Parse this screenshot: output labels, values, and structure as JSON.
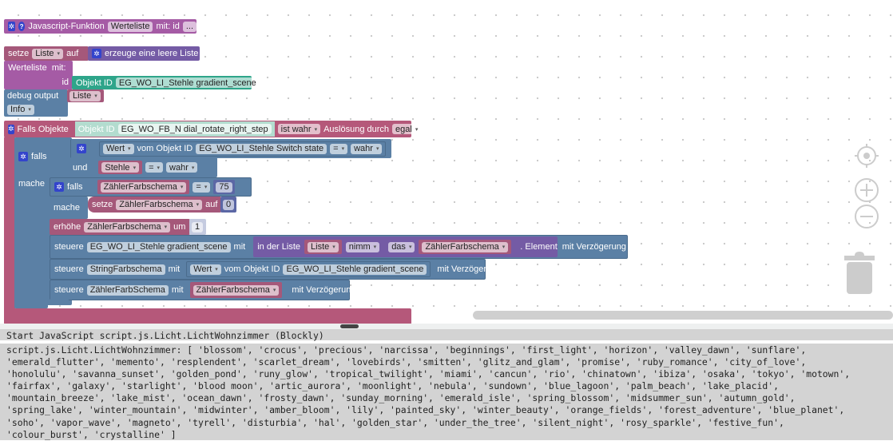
{
  "workspace": {
    "function_block": {
      "label": "Javascript-Funktion",
      "name": "Werteliste",
      "mit": "mit: id",
      "params": "..."
    },
    "set_block": {
      "setze": "setze",
      "var": "Liste",
      "auf": "auf",
      "create": "erzeuge eine leere Liste"
    },
    "werteliste_block": {
      "label": "Werteliste",
      "mit": "mit:",
      "id": "id",
      "objekt_id": "Objekt ID",
      "object": "EG_WO_LI_Stehle gradient_scene"
    },
    "debug_block": {
      "label": "debug output",
      "var": "Liste",
      "level": "Info"
    },
    "trigger_block": {
      "label": "Falls Objekte",
      "objekt_id": "Objekt ID",
      "object": "EG_WO_FB_N dial_rotate_right_step",
      "condition": "ist wahr",
      "trigger_label": "Auslösung durch",
      "trigger": "egal"
    },
    "if_block": {
      "falls": "falls",
      "mache": "mache",
      "und": "und",
      "cond1": {
        "wert": "Wert",
        "vom": "vom Objekt ID",
        "object": "EG_WO_LI_Stehle Switch state",
        "op": "=",
        "value": "wahr"
      },
      "cond2": {
        "var": "Stehle",
        "op": "=",
        "value": "wahr"
      }
    },
    "inner_if": {
      "falls": "falls",
      "mache": "mache",
      "var": "ZählerFarbschema",
      "op": "=",
      "value": "75",
      "setze": "setze",
      "set_var": "ZählerFarbschema",
      "auf": "auf",
      "set_value": "0"
    },
    "increment": {
      "label": "erhöhe",
      "var": "ZählerFarbschema",
      "um": "um",
      "value": "1"
    },
    "control1": {
      "steuere": "steuere",
      "object": "EG_WO_LI_Stehle gradient_scene",
      "mit": "mit",
      "in_list": "in der Liste",
      "list": "Liste",
      "nimm": "nimm",
      "das": "das",
      "index": "ZählerFarbschema",
      "element": ". Element",
      "delay": "mit Verzögerung"
    },
    "control2": {
      "steuere": "steuere",
      "object": "StringFarbschema",
      "mit": "mit",
      "wert": "Wert",
      "vom": "vom Objekt ID",
      "source": "EG_WO_LI_Stehle gradient_scene",
      "delay": "mit Verzögerung"
    },
    "control3": {
      "steuere": "steuere",
      "object": "ZählerFarbSchema",
      "mit": "mit",
      "var": "ZählerFarbschema",
      "delay": "mit Verzögerung"
    }
  },
  "console": {
    "header": "Start JavaScript script.js.Licht.LichtWohnzimmer (Blockly)",
    "lines": [
      "script.js.Licht.LichtWohnzimmer: [ 'blossom', 'crocus', 'precious', 'narcissa', 'beginnings', 'first_light', 'horizon', 'valley_dawn', 'sunflare',",
      "'emerald_flutter', 'memento', 'resplendent', 'scarlet_dream', 'lovebirds', 'smitten', 'glitz_and_glam', 'promise', 'ruby_romance', 'city_of_love',",
      "'honolulu', 'savanna_sunset', 'golden_pond', 'runy_glow', 'tropical_twilight', 'miami', 'cancun', 'rio', 'chinatown', 'ibiza', 'osaka', 'tokyo', 'motown',",
      "'fairfax', 'galaxy', 'starlight', 'blood moon', 'artic_aurora', 'moonlight', 'nebula', 'sundown', 'blue_lagoon', 'palm_beach', 'lake_placid',",
      "'mountain_breeze', 'lake_mist', 'ocean_dawn', 'frosty_dawn', 'sunday_morning', 'emerald_isle', 'spring_blossom', 'midsummer_sun', 'autumn_gold',",
      "'spring_lake', 'winter_mountain', 'midwinter', 'amber_bloom', 'lily', 'painted_sky', 'winter_beauty', 'orange_fields', 'forest_adventure', 'blue_planet',",
      "'soho', 'vapor_wave', 'magneto', 'tyrell', 'disturbia', 'hal', 'golden_star', 'under_the_tree', 'silent_night', 'rosy_sparkle', 'festive_fun',",
      "'colour_burst', 'crystalline' ]"
    ]
  },
  "colors": {
    "function": "#a55ba5",
    "variable": "#a5587a",
    "list": "#745ba5",
    "io": "#5b80a5",
    "object_id": "#2ea58a",
    "trigger": "#b5587a",
    "math": "#5b67a5"
  }
}
